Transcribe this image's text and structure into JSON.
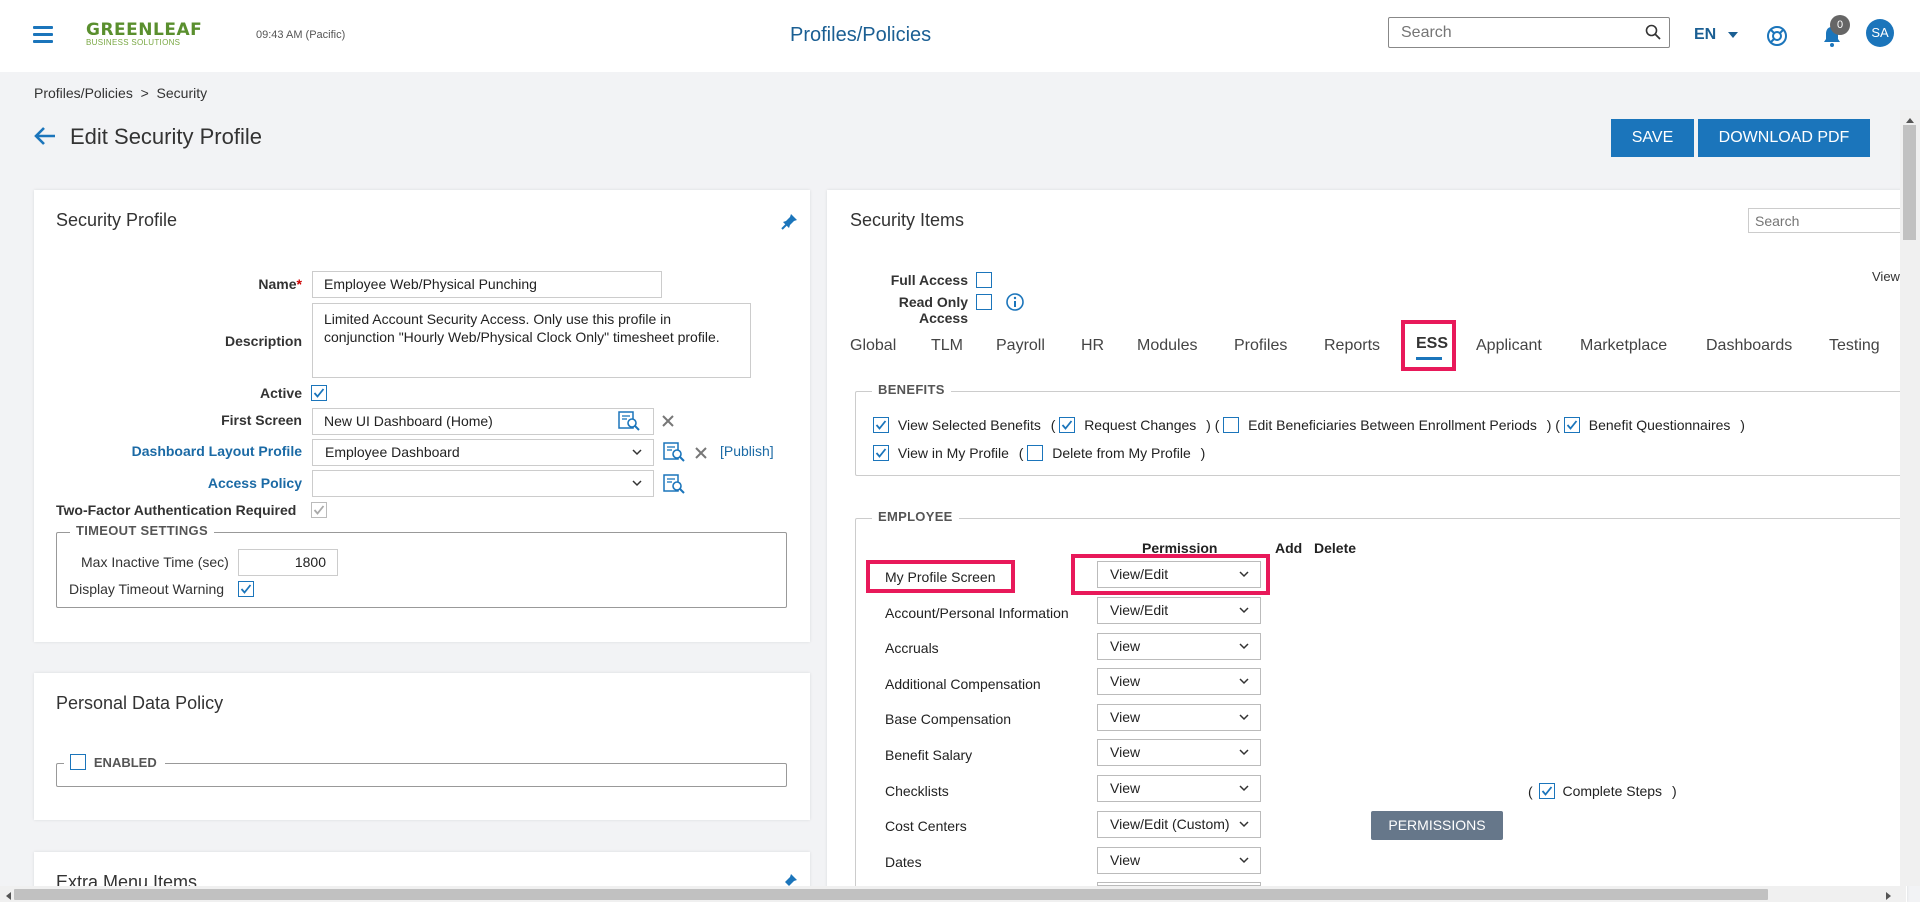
{
  "header": {
    "logo_line1": "GREENLEAF",
    "logo_line2": "BUSINESS SOLUTIONS",
    "time": "09:43 AM (Pacific)",
    "title": "Profiles/Policies",
    "search_placeholder": "Search",
    "language": "EN",
    "notification_count": "0",
    "avatar_initials": "SA"
  },
  "breadcrumb": "Profiles/Policies  >  Security",
  "page": {
    "heading": "Edit Security Profile",
    "save_label": "SAVE",
    "download_label": "DOWNLOAD PDF"
  },
  "security_profile": {
    "title": "Security Profile",
    "name_label": "Name",
    "name_value": "Employee Web/Physical Punching",
    "description_label": "Description",
    "description_value": "Limited Account Security Access. Only use this profile in conjunction \"Hourly Web/Physical Clock Only\" timesheet profile.",
    "active_label": "Active",
    "first_screen_label": "First Screen",
    "first_screen_value": "New UI Dashboard (Home)",
    "dashboard_layout_label": "Dashboard Layout Profile",
    "dashboard_layout_value": "Employee Dashboard",
    "publish_label": "[Publish]",
    "access_policy_label": "Access Policy",
    "access_policy_value": "",
    "two_factor_label": "Two-Factor Authentication Required",
    "timeout_legend": "TIMEOUT SETTINGS",
    "max_inactive_label": "Max Inactive Time (sec)",
    "max_inactive_value": "1800",
    "timeout_warning_label": "Display Timeout Warning"
  },
  "personal_data_policy": {
    "title": "Personal Data Policy",
    "enabled_label": "ENABLED"
  },
  "extra_menu": {
    "title": "Extra Menu Items"
  },
  "security_items": {
    "title": "Security Items",
    "search_placeholder": "Search",
    "full_access_label": "Full Access",
    "read_only_label": "Read Only Access",
    "view_label": "View",
    "tabs": [
      "Global",
      "TLM",
      "Payroll",
      "HR",
      "Modules",
      "Profiles",
      "Reports",
      "ESS",
      "Applicant",
      "Marketplace",
      "Dashboards",
      "Testing"
    ],
    "selected_tab": "ESS",
    "benefits": {
      "legend": "BENEFITS",
      "view_selected": "View Selected Benefits",
      "request_changes": "Request Changes",
      "edit_beneficiaries": "Edit Beneficiaries Between Enrollment Periods",
      "benefit_questionnaires": "Benefit Questionnaires",
      "view_in_profile": "View in My Profile",
      "delete_from_profile": "Delete from My Profile"
    },
    "employee": {
      "legend": "EMPLOYEE",
      "col_permission": "Permission",
      "col_add": "Add",
      "col_delete": "Delete",
      "rows": [
        {
          "name": "My Profile Screen",
          "permission": "View/Edit"
        },
        {
          "name": "Account/Personal Information",
          "permission": "View/Edit"
        },
        {
          "name": "Accruals",
          "permission": "View"
        },
        {
          "name": "Additional Compensation",
          "permission": "View"
        },
        {
          "name": "Base Compensation",
          "permission": "View"
        },
        {
          "name": "Benefit Salary",
          "permission": "View"
        },
        {
          "name": "Checklists",
          "permission": "View"
        },
        {
          "name": "Cost Centers",
          "permission": "View/Edit (Custom)"
        },
        {
          "name": "Dates",
          "permission": "View"
        }
      ],
      "complete_steps": "Complete Steps",
      "permissions_button": "PERMISSIONS"
    }
  },
  "colors": {
    "brand_blue": "#1b75bb",
    "highlight": "#e8195a",
    "logo_green": "#5a8f2e"
  }
}
